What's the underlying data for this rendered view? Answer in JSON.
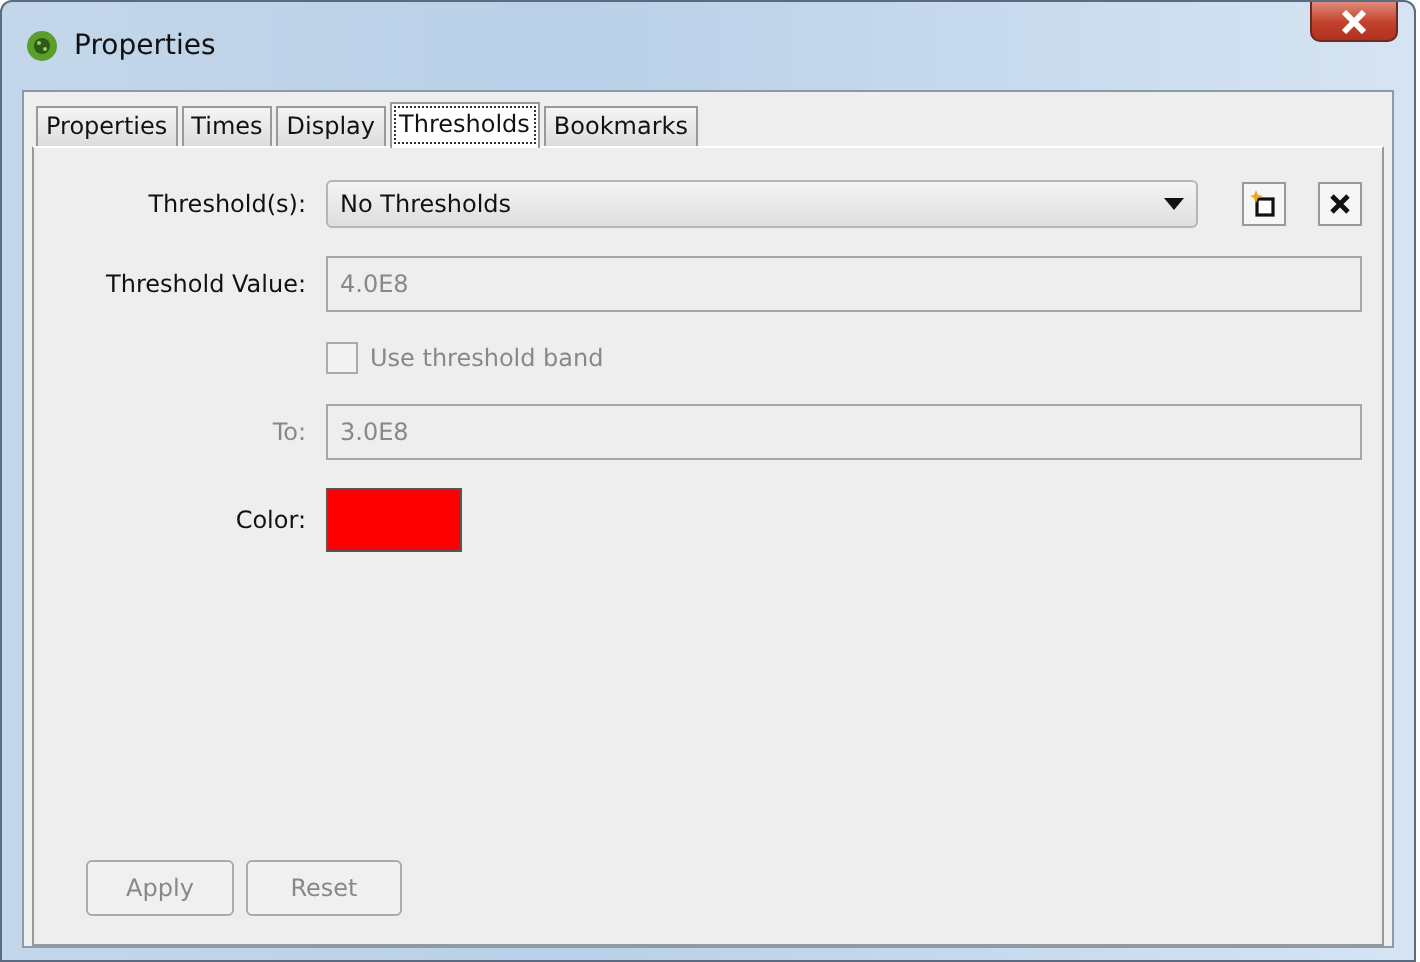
{
  "window": {
    "title": "Properties"
  },
  "tabs": [
    {
      "label": "Properties",
      "selected": false
    },
    {
      "label": "Times",
      "selected": false
    },
    {
      "label": "Display",
      "selected": false
    },
    {
      "label": "Thresholds",
      "selected": true
    },
    {
      "label": "Bookmarks",
      "selected": false
    }
  ],
  "thresholds": {
    "label": "Threshold(s):",
    "value": "No Thresholds"
  },
  "threshold_value": {
    "label": "Threshold Value:",
    "value": "4.0E8",
    "disabled": true
  },
  "band": {
    "label": "Use threshold band",
    "checked": false,
    "disabled": true
  },
  "to": {
    "label": "To:",
    "value": "3.0E8",
    "disabled": true
  },
  "color": {
    "label": "Color:",
    "color": "#ff0000"
  },
  "buttons": [
    {
      "label": "Apply",
      "disabled": true
    },
    {
      "label": "Reset",
      "disabled": true
    }
  ]
}
